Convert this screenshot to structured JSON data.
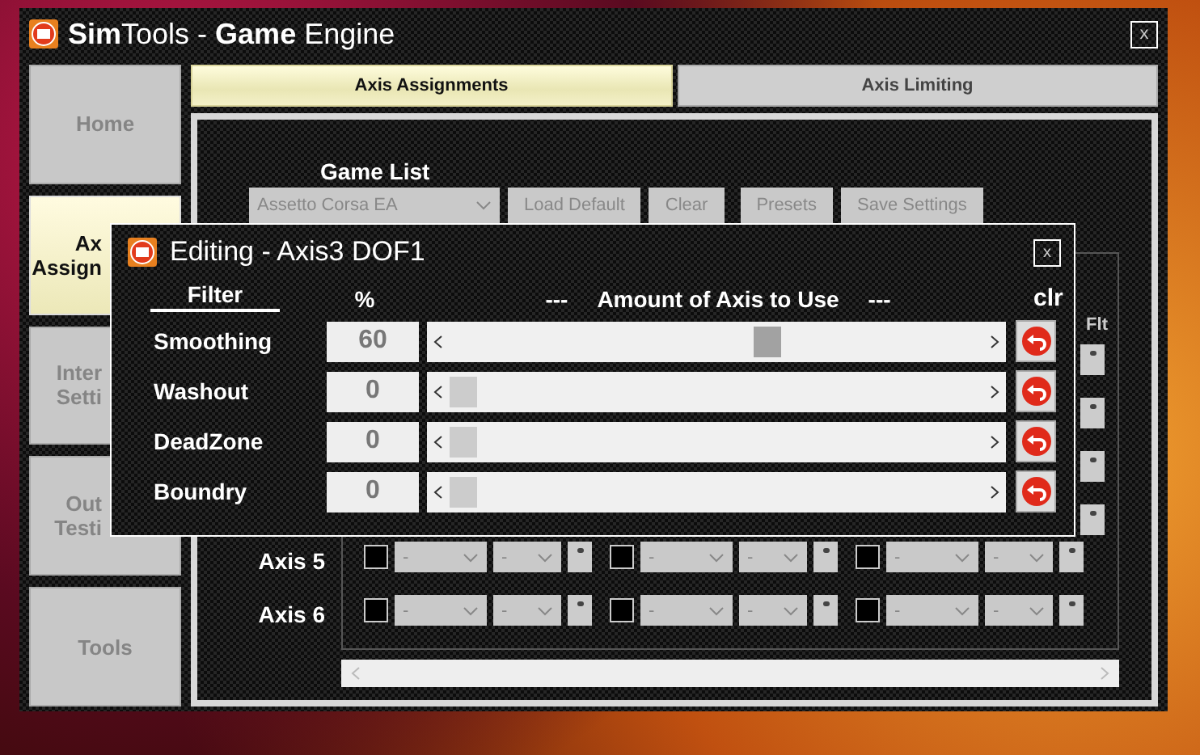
{
  "window": {
    "title": "**Sim**Tools - **Game** Engine",
    "close": "x"
  },
  "sidebar": {
    "items": [
      {
        "lines": [
          "Home"
        ],
        "selected": false
      },
      {
        "lines": [
          "Ax",
          "Assign"
        ],
        "selected": true
      },
      {
        "lines": [
          "Inter",
          "Setti"
        ],
        "selected": false
      },
      {
        "lines": [
          "Out",
          "Testi"
        ],
        "selected": false
      },
      {
        "lines": [
          "Tools"
        ],
        "selected": false
      }
    ]
  },
  "tabs": [
    {
      "label": "Axis Assignments",
      "selected": true
    },
    {
      "label": "Axis Limiting",
      "selected": false
    }
  ],
  "game_list": {
    "title": "Game List",
    "game": "Assetto Corsa EA",
    "buttons": [
      "Load Default",
      "Clear",
      "Presets",
      "Save Settings"
    ]
  },
  "grid": {
    "filter_header": "Flt",
    "rows": [
      {
        "label": "Axis 5",
        "groups": [
          {
            "checked": false,
            "value_1": "-",
            "value_2": "-"
          },
          {
            "checked": false,
            "value_1": "-",
            "value_2": "-"
          },
          {
            "checked": false,
            "value_1": "-",
            "value_2": "-"
          }
        ]
      },
      {
        "label": "Axis 6",
        "groups": [
          {
            "checked": false,
            "value_1": "-",
            "value_2": "-"
          },
          {
            "checked": false,
            "value_1": "-",
            "value_2": "-"
          },
          {
            "checked": false,
            "value_1": "-",
            "value_2": "-"
          }
        ]
      }
    ]
  },
  "dialog": {
    "title": "Editing - Axis3 DOF1",
    "close": "x",
    "headers": {
      "filter": "Filter",
      "percent": "%",
      "dash_left": "---",
      "amount": "Amount of Axis to Use",
      "dash_right": "---",
      "clear": "clr"
    },
    "filters": [
      {
        "name": "Smoothing",
        "value": "60",
        "level": 0.6
      },
      {
        "name": "Washout",
        "value": "0",
        "level": 0
      },
      {
        "name": "DeadZone",
        "value": "0",
        "level": 0
      },
      {
        "name": "Boundry",
        "value": "0",
        "level": 0
      }
    ]
  }
}
